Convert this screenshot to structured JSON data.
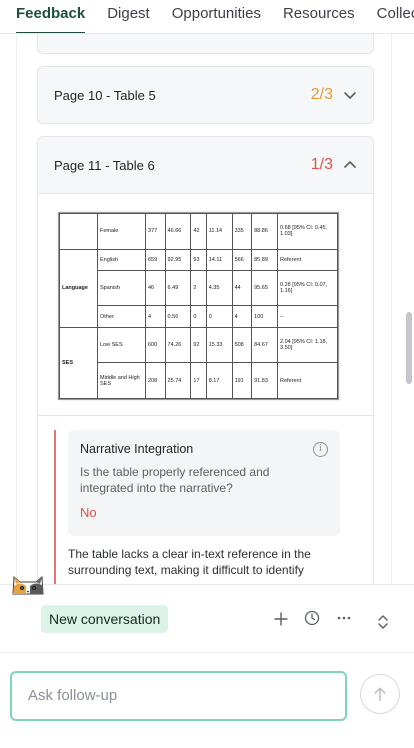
{
  "tabs": [
    "Feedback",
    "Digest",
    "Opportunities",
    "Resources",
    "Collec"
  ],
  "cards": {
    "p10": {
      "title": "Page 10 - Table 5",
      "score": "2/3",
      "score_color": "#e59a33"
    },
    "p11": {
      "title": "Page 11 - Table 6",
      "score": "1/3",
      "score_color": "#e0514b"
    }
  },
  "table_image": {
    "rows": [
      {
        "group": "",
        "label": "Female",
        "c1": "377",
        "c2": "46.66",
        "c3": "42",
        "c4": "11.14",
        "c5": "335",
        "c6": "88.86",
        "c7": "0.68 [95% CI: 0.45, 1.03]"
      },
      {
        "group": "Language",
        "label": "English",
        "c1": "659",
        "c2": "92.95",
        "c3": "93",
        "c4": "14.11",
        "c5": "566",
        "c6": "85.89",
        "c7": "Referent"
      },
      {
        "group": "",
        "label": "Spanish",
        "c1": "46",
        "c2": "6.49",
        "c3": "2",
        "c4": "4.35",
        "c5": "44",
        "c6": "95.65",
        "c7": "0.28 [95% CI: 0.07, 1.16]"
      },
      {
        "group": "",
        "label": "Other",
        "c1": "4",
        "c2": "0.56",
        "c3": "0",
        "c4": "0",
        "c5": "4",
        "c6": "100",
        "c7": "--"
      },
      {
        "group": "SES",
        "label": "Low SES",
        "c1": "600",
        "c2": "74.26",
        "c3": "92",
        "c4": "15.33",
        "c5": "508",
        "c6": "84.67",
        "c7": "2.04 [95% CI: 1.18, 3.50]"
      },
      {
        "group": "",
        "label": "Middle and High SES",
        "c1": "208",
        "c2": "25.74",
        "c3": "17",
        "c4": "8.17",
        "c5": "191",
        "c6": "91.83",
        "c7": "Referent"
      }
    ]
  },
  "criterion": {
    "title": "Narrative Integration",
    "question": "Is the table properly referenced and integrated into the narrative?",
    "answer": "No",
    "explanation": "The table lacks a clear in-text reference in the surrounding text, making it difficult to identify"
  },
  "chat": {
    "new_conversation": "New conversation",
    "placeholder": "Ask follow-up",
    "icons": [
      "plus-icon",
      "history-icon",
      "more-icon",
      "expand-icon",
      "send-arrow-icon"
    ]
  }
}
